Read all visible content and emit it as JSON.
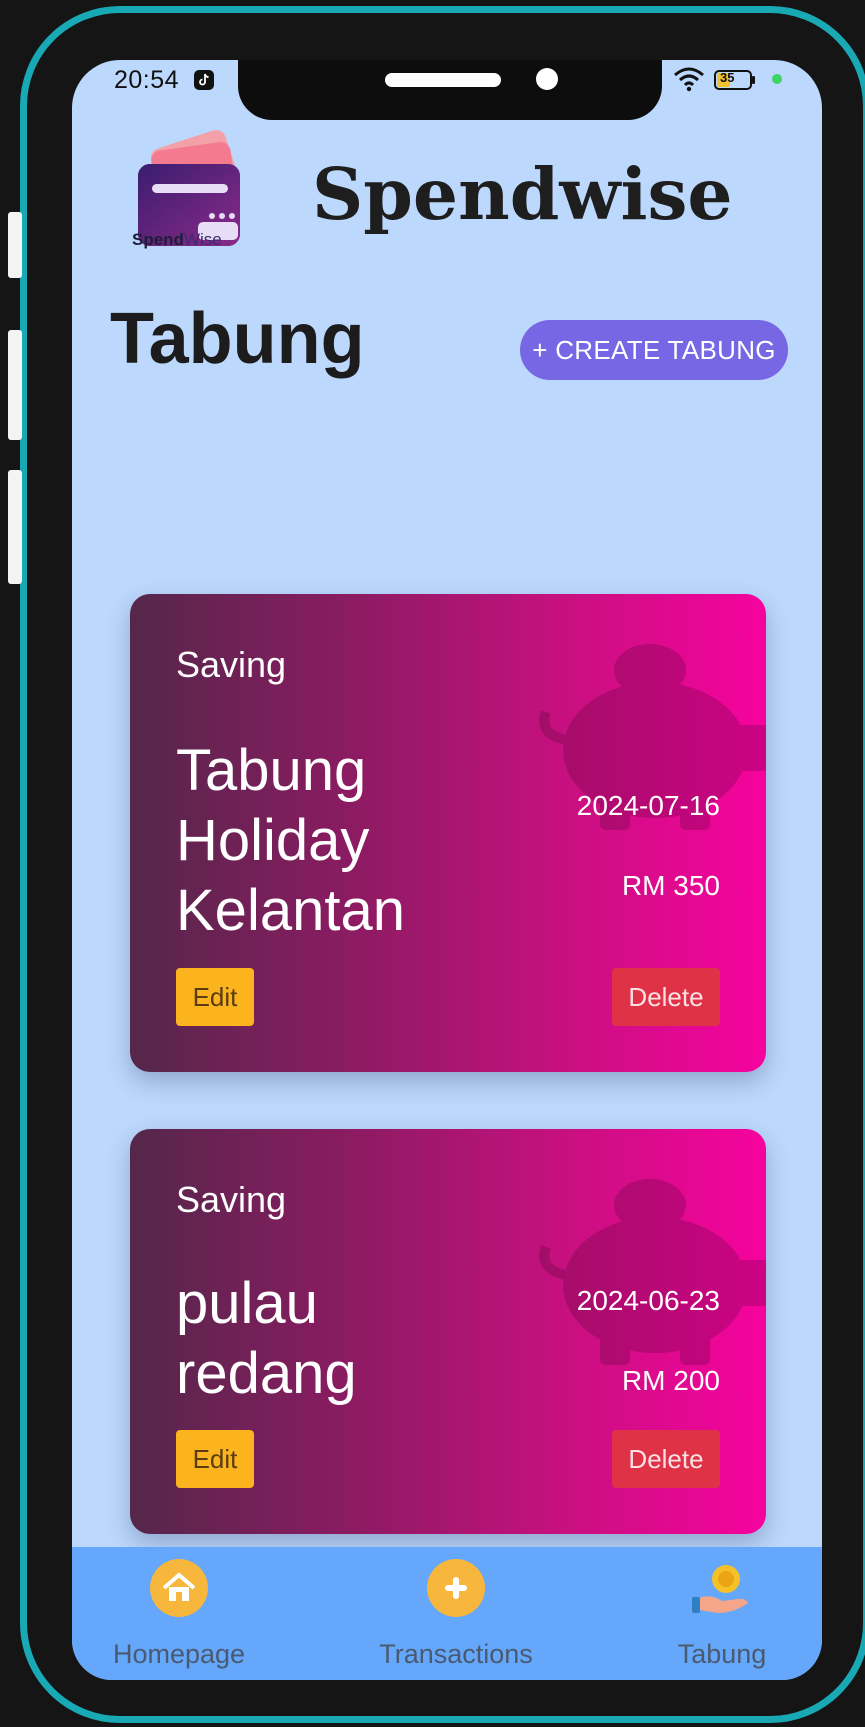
{
  "status_bar": {
    "time": "20:54",
    "battery": "35"
  },
  "app": {
    "name": "Spendwise",
    "logo_text_bold": "Spend",
    "logo_text_regular": "Wise"
  },
  "page": {
    "title": "Tabung",
    "create_button_label": "+ CREATE TABUNG"
  },
  "cards": [
    {
      "category": "Saving",
      "name": "Tabung Holiday Kelantan",
      "date": "2024-07-16",
      "amount": "RM 350",
      "edit_label": "Edit",
      "delete_label": "Delete"
    },
    {
      "category": "Saving",
      "name": "pulau redang",
      "date": "2024-06-23",
      "amount": "RM 200",
      "edit_label": "Edit",
      "delete_label": "Delete"
    }
  ],
  "bottom_nav": {
    "items": [
      {
        "label": "Homepage",
        "icon": "home-icon"
      },
      {
        "label": "Transactions",
        "icon": "plus-icon"
      },
      {
        "label": "Tabung",
        "icon": "coin-hand-icon"
      }
    ]
  },
  "colors": {
    "screen_background": "#bcd8fc",
    "accent_button": "#7767e4",
    "card_gradient_start": "#54274a",
    "card_gradient_end": "#f6039e",
    "edit_button": "#fbb41d",
    "delete_button": "#e03246",
    "bottom_nav": "#64a7fb",
    "frame": "#19a9b5"
  }
}
